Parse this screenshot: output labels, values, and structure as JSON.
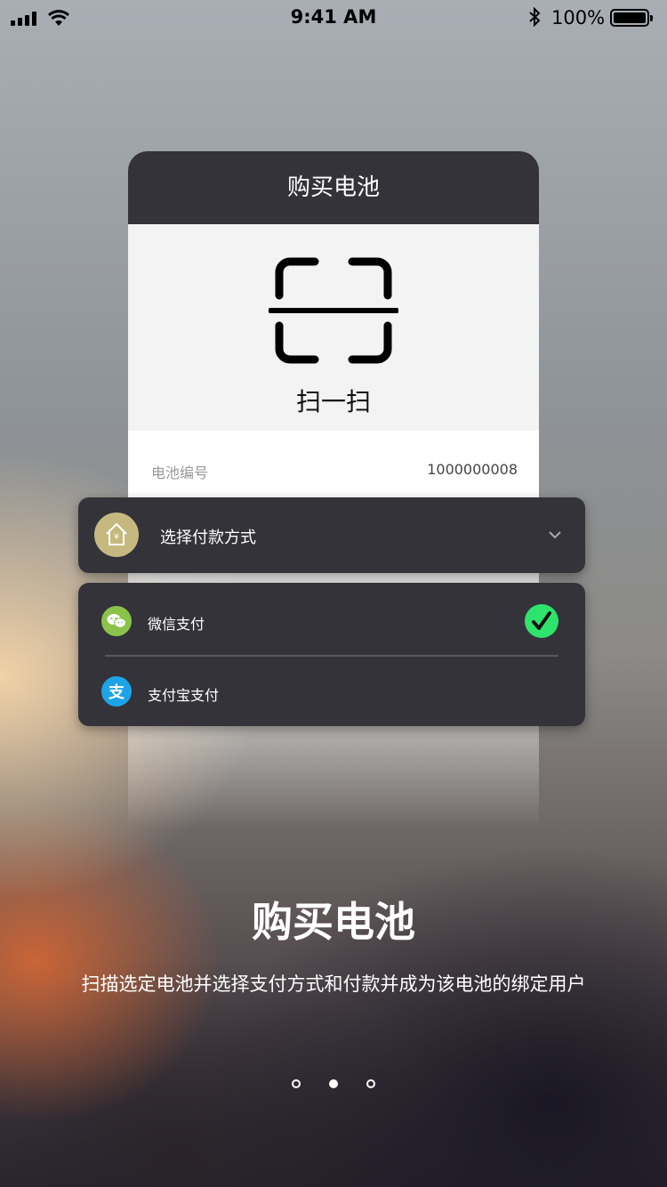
{
  "status_bar": {
    "time": "9:41 AM",
    "battery_text": "100%",
    "bluetooth_symbol": "✱"
  },
  "card": {
    "title": "购买电池",
    "scan_label": "扫一扫",
    "battery_label": "电池编号",
    "battery_value": "1000000008"
  },
  "payment": {
    "select_label": "选择付款方式",
    "options": [
      {
        "label": "微信支付",
        "icon": "wechat-icon",
        "selected": true
      },
      {
        "label": "支付宝支付",
        "icon": "alipay-icon",
        "selected": false
      }
    ]
  },
  "onboarding": {
    "headline": "购买电池",
    "subtitle": "扫描选定电池并选择支付方式和付款并成为该电池的绑定用户",
    "page_count": 3,
    "active_page": 2
  },
  "colors": {
    "card_header": "#333339",
    "check_green": "#2ee36c",
    "wechat_green": "#8bc34a",
    "alipay_blue": "#1da4e6",
    "select_icon_gold": "#c5b97f"
  }
}
